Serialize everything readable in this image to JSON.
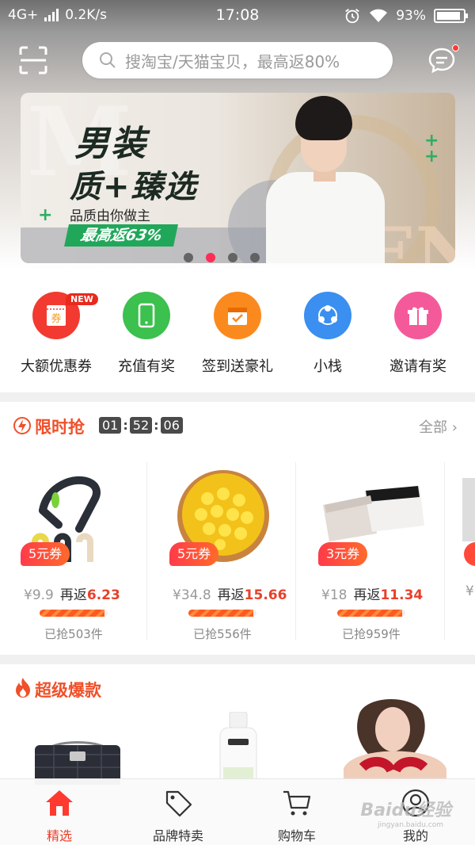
{
  "status_bar": {
    "network": "4G+",
    "speed": "0.2K/s",
    "time": "17:08",
    "battery": "93%"
  },
  "search": {
    "placeholder": "搜淘宝/天猫宝贝，最高返80%"
  },
  "banner": {
    "line1_a": "男装",
    "line2": "质+臻选",
    "subtitle": "品质由你做主",
    "promo": "最高返63%",
    "slides_count": 4,
    "active_slide": 1
  },
  "quick_menu": [
    {
      "label": "大额优惠券",
      "icon": "coupon-icon",
      "color": "#f23a30",
      "badge": "NEW",
      "glyph": "券"
    },
    {
      "label": "充值有奖",
      "icon": "phone-icon",
      "color": "#3cc04e"
    },
    {
      "label": "签到送豪礼",
      "icon": "calendar-icon",
      "color": "#fb8a1e"
    },
    {
      "label": "小栈",
      "icon": "share-nodes-icon",
      "color": "#3a8ff0"
    },
    {
      "label": "邀请有奖",
      "icon": "gift-icon",
      "color": "#f45a9a"
    }
  ],
  "flash_sale": {
    "title": "限时抢",
    "timer": [
      "01",
      "52",
      "06"
    ],
    "all_label": "全部",
    "products": [
      {
        "name": "car-headrest-hook",
        "coupon": "5元券",
        "orig_price": "¥9.9",
        "rebate_label": "再返",
        "rebate": "6.23",
        "sold": "已抢503件",
        "progress": 0.95
      },
      {
        "name": "sweet-corn",
        "coupon": "5元券",
        "orig_price": "¥34.8",
        "rebate_label": "再返",
        "rebate": "15.66",
        "sold": "已抢556件",
        "progress": 0.95
      },
      {
        "name": "safety-shorts",
        "coupon": "3元券",
        "orig_price": "¥18",
        "rebate_label": "再返",
        "rebate": "11.34",
        "sold": "已抢959件",
        "progress": 0.95
      },
      {
        "name": "partial-card",
        "orig_price": "¥"
      }
    ]
  },
  "hot": {
    "title": "超级爆款"
  },
  "tabbar": [
    {
      "label": "精选",
      "icon": "home-icon",
      "active": true
    },
    {
      "label": "品牌特卖",
      "icon": "tag-icon",
      "active": false
    },
    {
      "label": "购物车",
      "icon": "cart-icon",
      "active": false
    },
    {
      "label": "我的",
      "icon": "user-icon",
      "active": false
    }
  ],
  "watermark": "Baidu经验",
  "watermark_url": "jingyan.baidu.com"
}
